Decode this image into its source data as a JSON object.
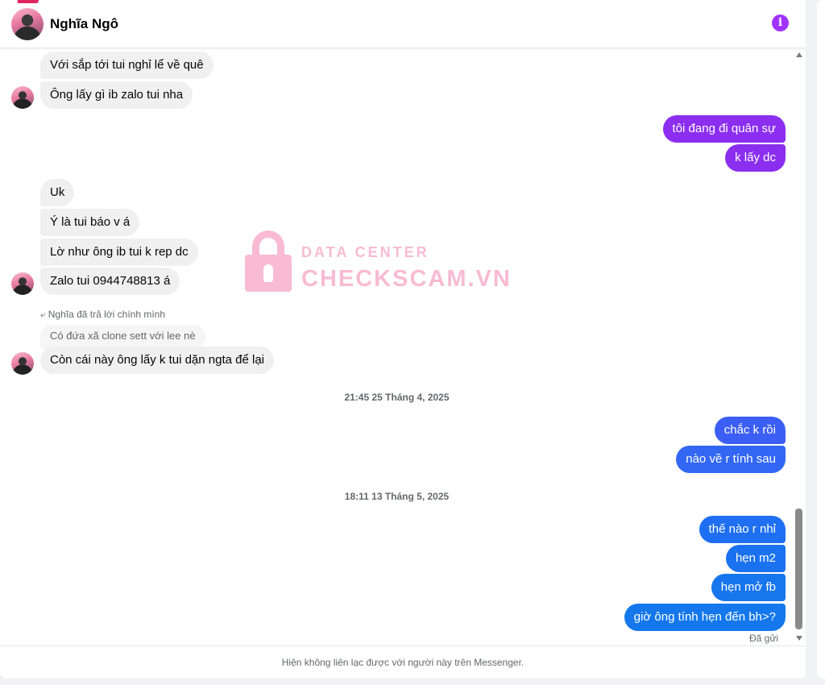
{
  "header": {
    "contact_name": "Nghĩa Ngô",
    "info_icon": "i"
  },
  "colors": {
    "purple_bubble": "#8b2ef0",
    "blue_bubble": "#1877f2",
    "incoming_bubble": "#f0f0f0",
    "info_icon": "#a033ff"
  },
  "messages": [
    {
      "dir": "in",
      "text": "Với sắp tới tui nghỉ lể về quê"
    },
    {
      "dir": "in",
      "text": "Ông lấy gì ib zalo tui nha"
    },
    {
      "dir": "out",
      "text": "tôi đang đi quân sự"
    },
    {
      "dir": "out",
      "text": "k lấy dc"
    },
    {
      "dir": "in",
      "text": "Uk"
    },
    {
      "dir": "in",
      "text": "Ý là tui báo v á"
    },
    {
      "dir": "in",
      "text": "Lờ như ông ib tui k rep dc"
    },
    {
      "dir": "in",
      "text": "Zalo tui 0944748813 á"
    },
    {
      "dir": "in",
      "text": "Còn cái này ông lấy k tui dặn ngta để lại"
    },
    {
      "dir": "out",
      "text": "chắc k rồi"
    },
    {
      "dir": "out",
      "text": "nào về r tính sau"
    },
    {
      "dir": "out",
      "text": "thế nào r nhỉ"
    },
    {
      "dir": "out",
      "text": "hẹn m2"
    },
    {
      "dir": "out",
      "text": "hẹn mở fb"
    },
    {
      "dir": "out",
      "text": "giờ ông tính hẹn đến bh>?"
    }
  ],
  "reply": {
    "note": "Nghĩa đã trả lời chính mình",
    "quoted": "Có đứa xã clone sett với lee nè"
  },
  "timestamps": [
    "21:45 25 Tháng 4, 2025",
    "18:11 13 Tháng 5, 2025"
  ],
  "status": {
    "seen": "Đã gửi"
  },
  "footer": {
    "notice": "Hiện không liên lạc được với người này trên Messenger."
  },
  "watermark": {
    "line1": "DATA CENTER",
    "line2": "CHECKSCAM.VN"
  }
}
